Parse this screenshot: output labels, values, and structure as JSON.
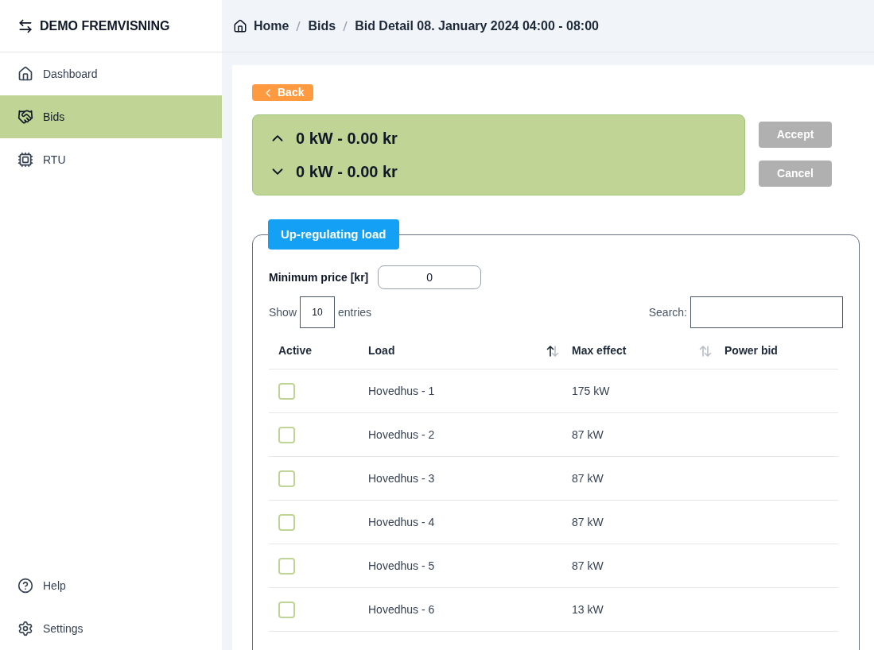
{
  "brand": {
    "title": "DEMO FREMVISNING"
  },
  "sidebar": {
    "items": [
      {
        "label": "Dashboard",
        "selected": false
      },
      {
        "label": "Bids",
        "selected": true
      },
      {
        "label": "RTU",
        "selected": false
      }
    ],
    "bottom_items": [
      {
        "label": "Help"
      },
      {
        "label": "Settings"
      }
    ]
  },
  "breadcrumb": [
    "Home",
    "Bids",
    "Bid Detail 08. January 2024 04:00 - 08:00"
  ],
  "back_button": "Back",
  "summary": [
    {
      "text": "0 kW - 0.00 kr"
    },
    {
      "text": "0 kW - 0.00 kr"
    }
  ],
  "actions": [
    {
      "label": "Accept",
      "disabled": true
    },
    {
      "label": "Cancel",
      "disabled": true
    }
  ],
  "section": {
    "title": "Up-regulating load",
    "minimum_price": {
      "label": "Minimum price [kr]",
      "value": "0"
    },
    "show_label": "Show",
    "entries_value": "10",
    "entries_label": "entries",
    "search_label": "Search:",
    "table": {
      "columns": [
        {
          "label": "Active",
          "kind": "plain"
        },
        {
          "label": "Load",
          "kind": "sortable",
          "sorted": true
        },
        {
          "label": "Max effect",
          "kind": "sortable",
          "sorted": false
        },
        {
          "label": "Power bid",
          "kind": "plain"
        }
      ],
      "rows": [
        {
          "checked": false,
          "load": "Hovedhus - 1",
          "max_effect": "175 kW"
        },
        {
          "checked": false,
          "load": "Hovedhus - 2",
          "max_effect": "87 kW"
        },
        {
          "checked": false,
          "load": "Hovedhus - 3",
          "max_effect": "87 kW"
        },
        {
          "checked": false,
          "load": "Hovedhus - 4",
          "max_effect": "87 kW"
        },
        {
          "checked": false,
          "load": "Hovedhus - 5",
          "max_effect": "87 kW"
        },
        {
          "checked": false,
          "load": "Hovedhus - 6",
          "max_effect": "13 kW"
        }
      ]
    }
  }
}
